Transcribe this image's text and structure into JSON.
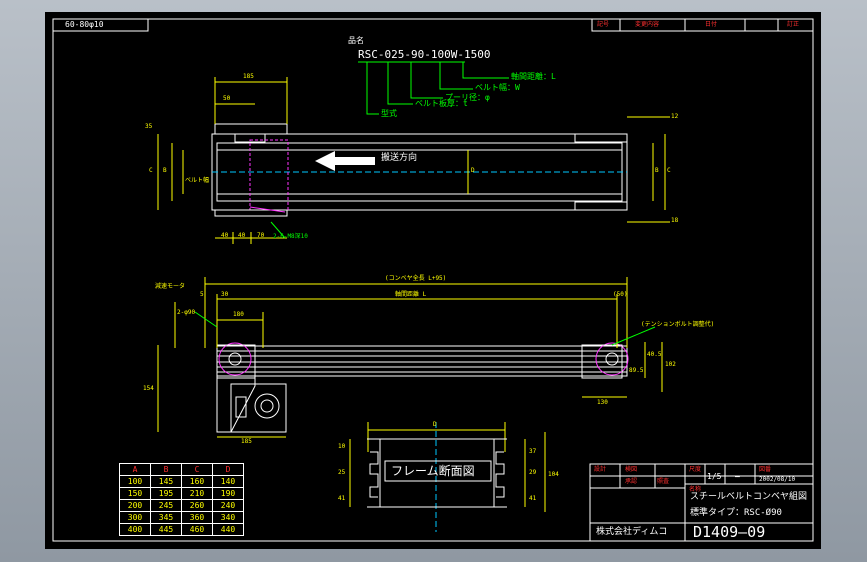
{
  "sheet": {
    "size_label": "60-80φ10",
    "revision_headers": [
      "記号",
      "変更内容",
      "日付",
      "訂正"
    ],
    "part_name_label": "品名",
    "model": "RSC-025-90-100W-1500",
    "model_legend": {
      "axis": "軸間距離：L",
      "belt_width": "ベルト幅：W",
      "pulley": "プーリ径：φ",
      "belt_thickness": "ベルト板厚：t",
      "type": "型式"
    },
    "direction_label": "搬送方向",
    "belt_width_label": "ベルト幅",
    "dims_top": {
      "d185": "185",
      "d50": "50",
      "d35": "35",
      "d12": "12",
      "d18": "18",
      "c": "C",
      "b": "B",
      "d": "D",
      "d40a": "40",
      "d40b": "40",
      "d70": "70",
      "hole_note": "2-6-M8深10"
    },
    "dims_front": {
      "total": "(コンベヤ全長 L+95)",
      "axis": "軸間距離 L",
      "d5": "5",
      "d30": "30",
      "d50": "(50)",
      "motor_label": "減速モータ",
      "d180": "180",
      "phi90": "2-φ90",
      "d154": "154",
      "d185": "185",
      "tension": "(テンションボルト調整代)",
      "d40": "40.5",
      "d102": "102",
      "d89": "89.5",
      "d130": "130"
    },
    "section": {
      "title": "フレーム断面図",
      "d": "D",
      "left": [
        "10",
        "25",
        "41"
      ],
      "right": [
        "37",
        "29",
        "41"
      ],
      "height": "104"
    },
    "table": {
      "headers": [
        "A",
        "B",
        "C",
        "D"
      ],
      "rows": [
        [
          "100",
          "145",
          "160",
          "140"
        ],
        [
          "150",
          "195",
          "210",
          "190"
        ],
        [
          "200",
          "245",
          "260",
          "240"
        ],
        [
          "300",
          "345",
          "360",
          "340"
        ],
        [
          "400",
          "445",
          "460",
          "440"
        ]
      ]
    },
    "titleblock": {
      "labels": [
        "設計",
        "検図",
        "尺度",
        "図番",
        "名称",
        "承認",
        "照査"
      ],
      "scale": "1/5",
      "date": "2002/08/10",
      "dash": "—",
      "title1": "スチールベルトコンベヤ組図",
      "title2": "標準タイプ：RSC-Ø90",
      "company": "株式会社ディムコ",
      "drawing_no": "D1409—09"
    }
  },
  "colors": {
    "background": "#000000",
    "line": "#ffffff",
    "dimension": "#ffff00",
    "leader": "#00ff00",
    "hidden": "#ff33ff",
    "label": "#ff3030"
  }
}
